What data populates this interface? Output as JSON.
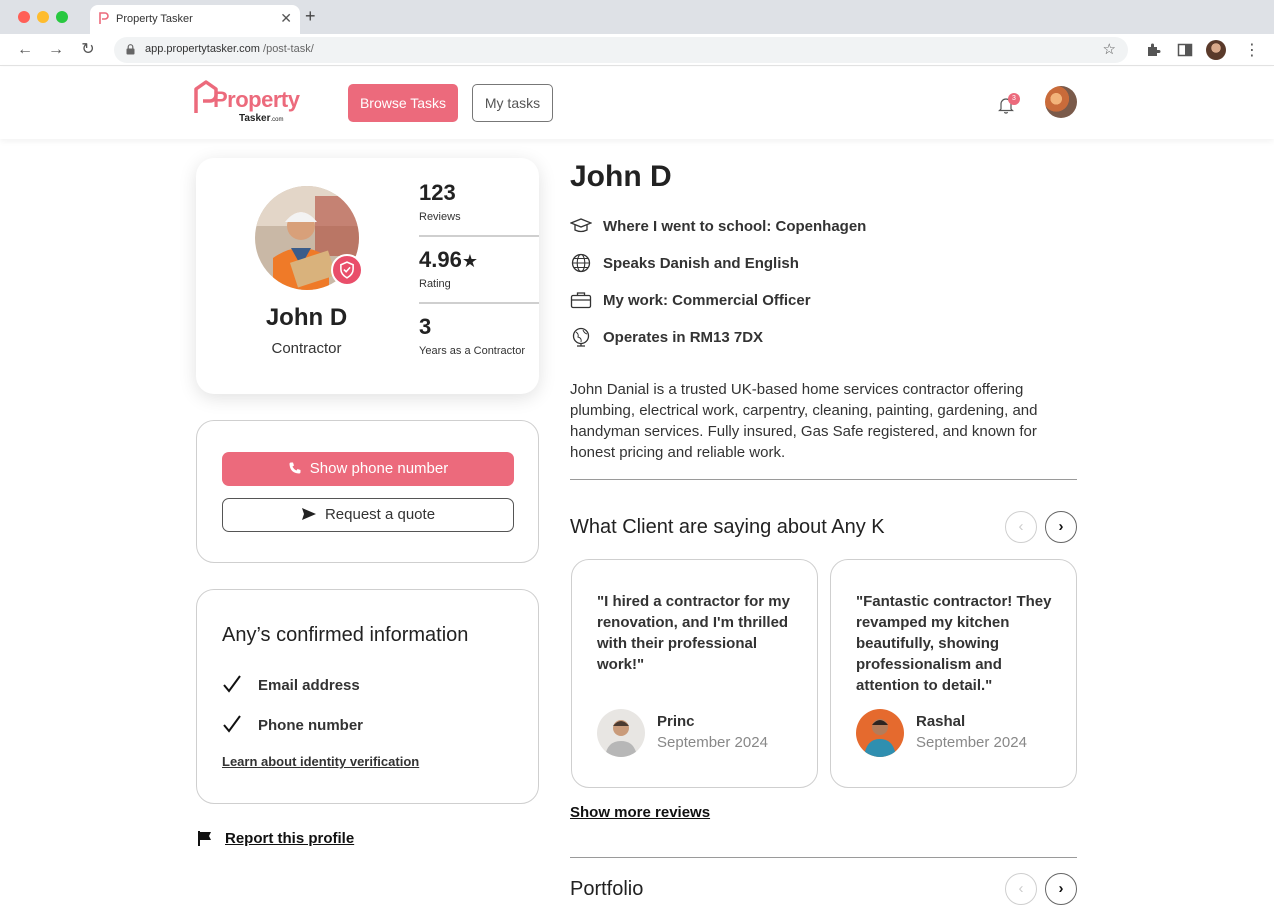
{
  "browser": {
    "tab_title": "Property Tasker",
    "url_host": "app.propertytasker.com",
    "url_path": "/post-task/"
  },
  "header": {
    "logo_word": "Property",
    "logo_sub": "Tasker",
    "logo_sub_tld": ".com",
    "browse_label": "Browse Tasks",
    "mytasks_label": "My tasks",
    "notification_count": "3"
  },
  "profile": {
    "name": "John D",
    "role": "Contractor",
    "stats": [
      {
        "value": "123",
        "label": "Reviews"
      },
      {
        "value": "4.96",
        "label": "Rating"
      },
      {
        "value": "3",
        "label": "Years as a Contractor"
      }
    ],
    "rating_star": "★"
  },
  "contact": {
    "phone_label": "Show phone number",
    "quote_label": "Request a quote"
  },
  "confirmed": {
    "title": "Any’s confirmed information",
    "items": [
      "Email address",
      "Phone number"
    ],
    "learn_label": "Learn about identity verification"
  },
  "report_label": "Report this profile",
  "details": {
    "name": "John D",
    "rows": [
      {
        "icon": "graduation-cap-icon",
        "text": "Where I went to school: Copenhagen"
      },
      {
        "icon": "globe-icon",
        "text": "Speaks Danish and English"
      },
      {
        "icon": "briefcase-icon",
        "text": "My work: Commercial Officer"
      },
      {
        "icon": "location-globe-icon",
        "text": "Operates in RM13 7DX"
      }
    ],
    "bio": "John Danial is a trusted UK-based home services contractor offering plumbing, electrical work, carpentry, cleaning, painting, gardening, and handyman services. Fully insured, Gas Safe registered, and known for honest pricing and reliable work."
  },
  "reviews": {
    "title": "What Client are saying about Any K",
    "items": [
      {
        "text": "\"I hired a contractor for my renovation, and I'm thrilled with their professional work!\"",
        "name": "Princ",
        "date": "September 2024"
      },
      {
        "text": "\"Fantastic contractor! They revamped my kitchen beautifully, showing professionalism and attention to detail.\"",
        "name": "Rashal",
        "date": "September 2024"
      }
    ],
    "show_more_label": "Show more reviews"
  },
  "portfolio": {
    "title": "Portfolio"
  },
  "colors": {
    "brand": "#ec6a7c",
    "verified": "#e94e6a"
  }
}
